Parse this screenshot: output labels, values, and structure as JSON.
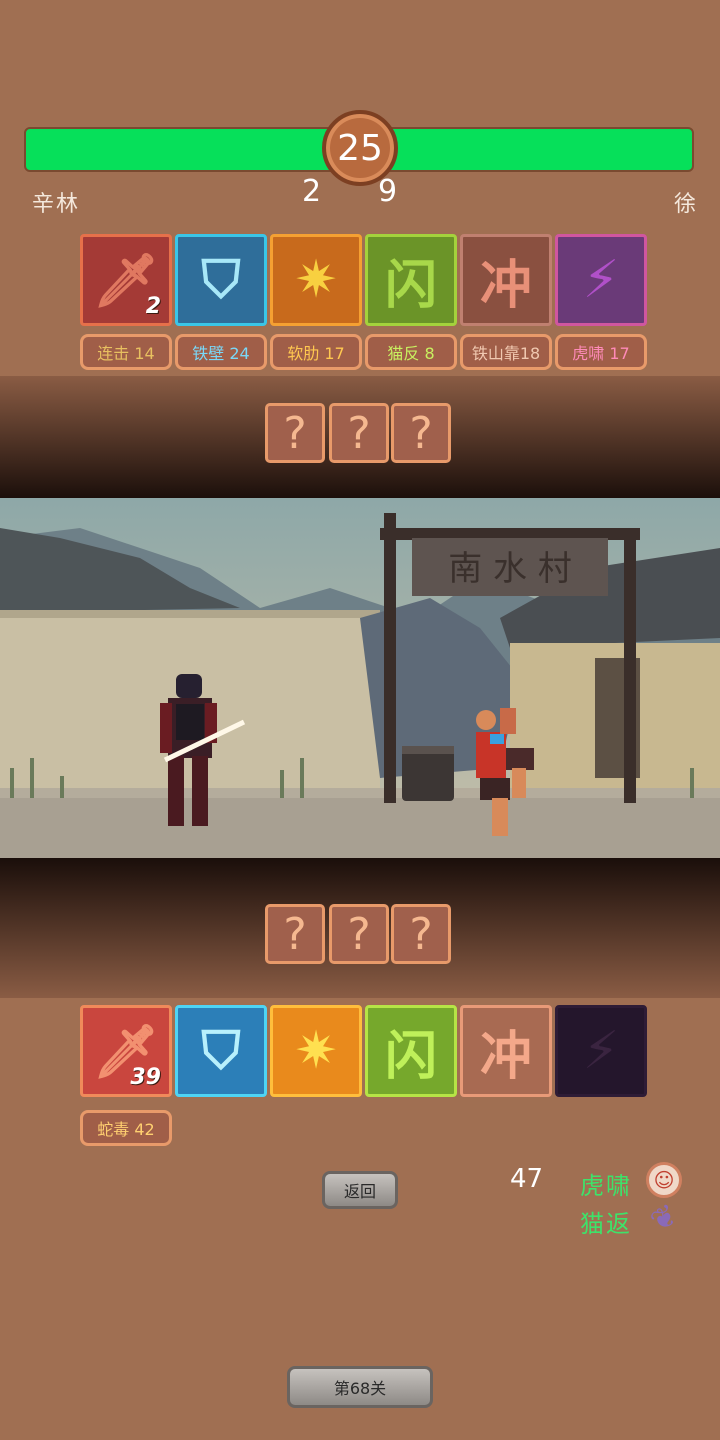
{
  "round": "25",
  "scores": {
    "left": "2",
    "right": "9"
  },
  "players": {
    "left_name": "辛林",
    "right_name": "徐"
  },
  "enemy_cards": [
    {
      "icon": "sword-icon",
      "glyph": "🗡",
      "count": "2"
    },
    {
      "icon": "shield-icon",
      "glyph": "⛉",
      "count": ""
    },
    {
      "icon": "broken-shield-icon",
      "glyph": "✷",
      "count": ""
    },
    {
      "icon": "dodge-icon",
      "glyph": "闪",
      "count": ""
    },
    {
      "icon": "charge-icon",
      "glyph": "冲",
      "count": ""
    },
    {
      "icon": "lightning-icon",
      "glyph": "⚡",
      "count": ""
    }
  ],
  "enemy_skills": [
    {
      "label": "连击 14",
      "color": "#e8c060"
    },
    {
      "label": "铁壁 24",
      "color": "#7ad8f8"
    },
    {
      "label": "软肋 17",
      "color": "#ffc850"
    },
    {
      "label": "猫反  8",
      "color": "#c8f060"
    },
    {
      "label": "铁山靠18",
      "color": "#f0c8b0"
    },
    {
      "label": "虎啸 17",
      "color": "#ff8ab8"
    }
  ],
  "unknown_mark": "?",
  "player_cards": [
    {
      "icon": "sword-icon",
      "glyph": "🗡",
      "count": "39"
    },
    {
      "icon": "shield-icon",
      "glyph": "⛉",
      "count": ""
    },
    {
      "icon": "broken-shield-icon",
      "glyph": "✷",
      "count": ""
    },
    {
      "icon": "dodge-icon",
      "glyph": "闪",
      "count": ""
    },
    {
      "icon": "charge-icon",
      "glyph": "冲",
      "count": ""
    },
    {
      "icon": "lightning-icon",
      "glyph": "⚡",
      "count": ""
    }
  ],
  "player_skills": [
    {
      "label": "蛇毒 42",
      "color": "#ffd070"
    }
  ],
  "back_button": "返回",
  "score_value": "47",
  "buffs": [
    {
      "label": "虎啸",
      "icon": "monk-icon"
    },
    {
      "label": "猫返",
      "icon": "feather-icon"
    }
  ],
  "level_button": "第68关",
  "scene": {
    "gate_sign": "南 水 村"
  },
  "colors": {
    "hp_green": "#06e05a",
    "background": "#a06f52"
  }
}
